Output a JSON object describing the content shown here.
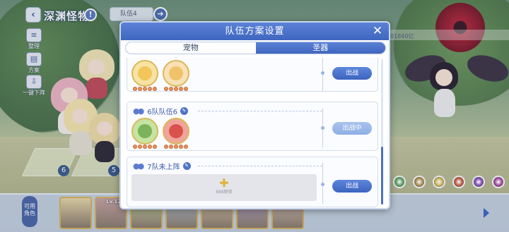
{
  "hud": {
    "back_icon": "chevron-left-icon",
    "stage_title": "深渊怪物",
    "team_selector": "队伍4",
    "power_value": "01840亿",
    "side_tools": [
      {
        "icon": "organize-icon",
        "label": "整理"
      },
      {
        "icon": "formation-icon",
        "label": "方案"
      },
      {
        "icon": "unload-icon",
        "label": "一键下阵"
      }
    ]
  },
  "battlefield": {
    "slot_numbers": [
      "6",
      "5"
    ]
  },
  "modal": {
    "title": "队伍方案设置",
    "close_icon": "close-icon",
    "tabs": [
      {
        "label": "宠物",
        "active": false
      },
      {
        "label": "圣器",
        "active": true
      }
    ],
    "teams": [
      {
        "name": "",
        "relics": [
          {
            "icon": "holy-cross-relic-icon",
            "color": "#f2c65a"
          },
          {
            "icon": "winged-sun-relic-icon",
            "color": "#f0c36b"
          }
        ],
        "button": "出战",
        "button_state": "primary"
      },
      {
        "name": "6队队伍6",
        "relics": [
          {
            "icon": "eye-relic-icon",
            "color": "#7bb35a"
          },
          {
            "icon": "dragon-claw-relic-icon",
            "color": "#d9524e"
          }
        ],
        "button": "出战中",
        "button_state": "light"
      },
      {
        "name": "7队未上阵",
        "empty_slot_label": "888解锁",
        "button": "出战",
        "button_state": "primary"
      }
    ]
  },
  "roster": {
    "button_label": "可用角色",
    "cards": [
      {
        "level": "",
        "color": "#e9d8a8"
      },
      {
        "level": "Lv.120",
        "color": "#c9a4a4"
      },
      {
        "level": "",
        "color": "#cdd8a4"
      },
      {
        "level": "",
        "color": "#b7c6d8"
      },
      {
        "level": "",
        "color": "#dcc6a8"
      },
      {
        "level": "",
        "color": "#b5a6c9"
      },
      {
        "level": "",
        "color": "#d9c3b8"
      }
    ],
    "next_icon": "chevron-right-icon"
  },
  "elements": [
    {
      "icon": "wind-element-icon",
      "color": "#6fbf6a"
    },
    {
      "icon": "earth-element-icon",
      "color": "#c9a45a"
    },
    {
      "icon": "light-element-icon",
      "color": "#f0d060"
    },
    {
      "icon": "fire-element-icon",
      "color": "#e06a4a"
    },
    {
      "icon": "dark-element-icon",
      "color": "#9a5ac8"
    },
    {
      "icon": "chaos-element-icon",
      "color": "#c056b0"
    }
  ]
}
